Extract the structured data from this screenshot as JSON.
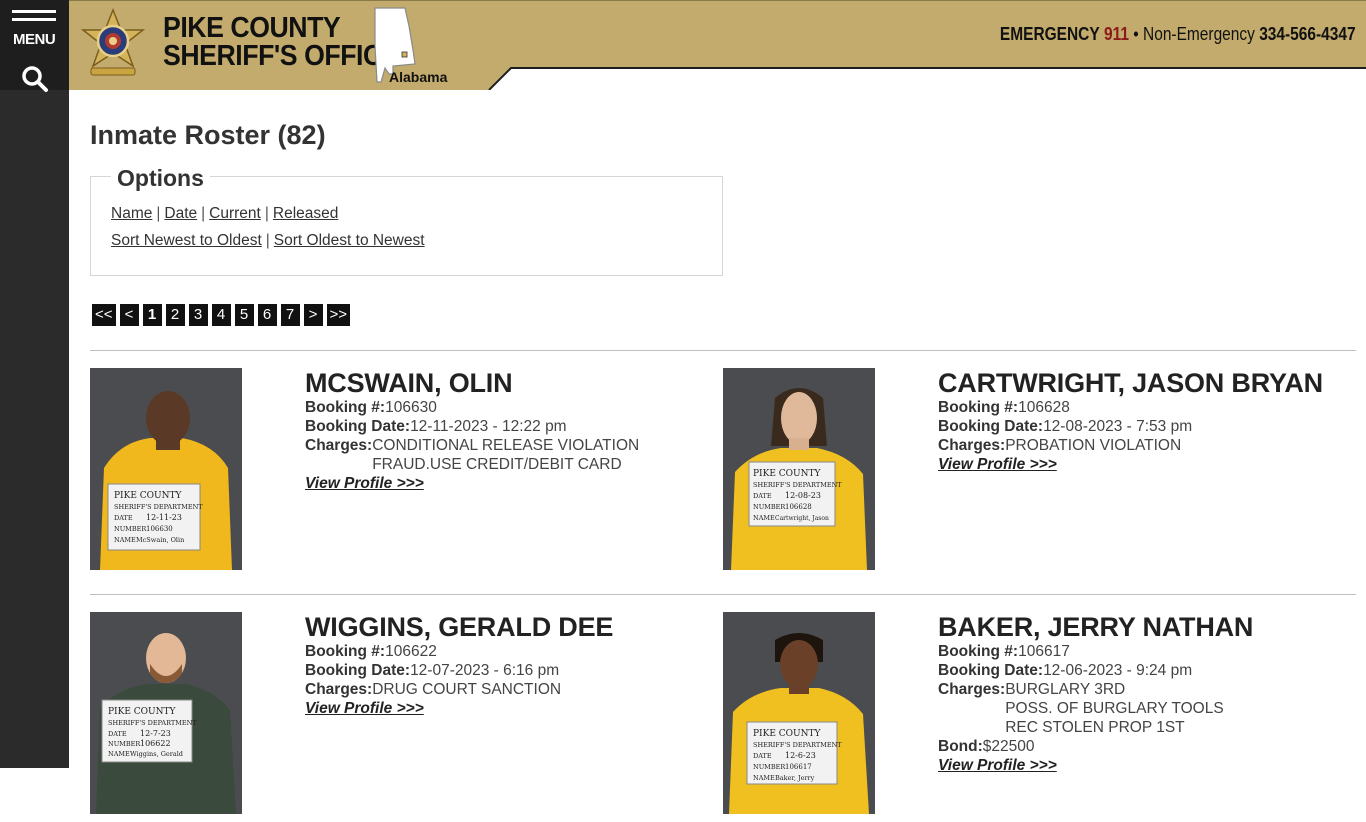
{
  "nav": {
    "menu_label": "MENU",
    "search_icon": "search-icon",
    "menu_icon": "hamburger-icon"
  },
  "header": {
    "org_line1": "PIKE COUNTY",
    "org_line2": "SHERIFF'S OFFICE",
    "state": "Alabama",
    "emergency_label": "EMERGENCY",
    "emergency_number": "911",
    "separator": "•",
    "nonemergency_label": "Non-Emergency",
    "nonemergency_number": "334-566-4347",
    "colors": {
      "gold": "#c2ab6c",
      "dark": "#1e1e1e",
      "red": "#8b1a1a"
    }
  },
  "page": {
    "title": "Inmate Roster (82)"
  },
  "options": {
    "legend": "Options",
    "filters": [
      "Name",
      "Date",
      "Current",
      "Released"
    ],
    "sorts": [
      "Sort Newest to Oldest",
      "Sort Oldest to Newest"
    ],
    "sep": "|"
  },
  "pager": {
    "first": "<<",
    "prev": "<",
    "pages": [
      "1",
      "2",
      "3",
      "4",
      "5",
      "6",
      "7"
    ],
    "current": "1",
    "next": ">",
    "last": ">>"
  },
  "labels": {
    "booking_num": "Booking #:",
    "booking_date": "Booking Date:",
    "charges": "Charges:",
    "bond": "Bond:",
    "view_profile": "View Profile >>>"
  },
  "inmates": [
    {
      "name": "MCSWAIN, OLIN",
      "booking_num": "106630",
      "booking_date": "12-11-2023 - 12:22 pm",
      "charges": [
        "CONDITIONAL RELEASE VIOLATION",
        "FRAUD.USE CREDIT/DEBIT CARD"
      ],
      "placard": {
        "date": "12-11-23",
        "number": "106630",
        "name": "McSwain, Olin"
      }
    },
    {
      "name": "CARTWRIGHT, JASON BRYAN",
      "booking_num": "106628",
      "booking_date": "12-08-2023 - 7:53 pm",
      "charges": [
        "PROBATION VIOLATION"
      ],
      "placard": {
        "date": "12-08-23",
        "number": "106628",
        "name": "Cartwright, Jason"
      }
    },
    {
      "name": "WIGGINS, GERALD DEE",
      "booking_num": "106622",
      "booking_date": "12-07-2023 - 6:16 pm",
      "charges": [
        "DRUG COURT SANCTION"
      ],
      "placard": {
        "date": "12-7-23",
        "number": "106622",
        "name": "Wiggins, Gerald"
      }
    },
    {
      "name": "BAKER, JERRY NATHAN",
      "booking_num": "106617",
      "booking_date": "12-06-2023 - 9:24 pm",
      "charges": [
        "BURGLARY 3RD",
        "POSS. OF BURGLARY TOOLS",
        "REC STOLEN PROP 1ST"
      ],
      "bond": "$22500",
      "placard": {
        "date": "12-6-23",
        "number": "106617",
        "name": "Baker, Jerry"
      }
    }
  ],
  "placard_text": {
    "title": "PIKE COUNTY",
    "dept": "SHERIFF'S DEPARTMENT",
    "date": "DATE",
    "number": "NUMBER",
    "name": "NAME"
  }
}
